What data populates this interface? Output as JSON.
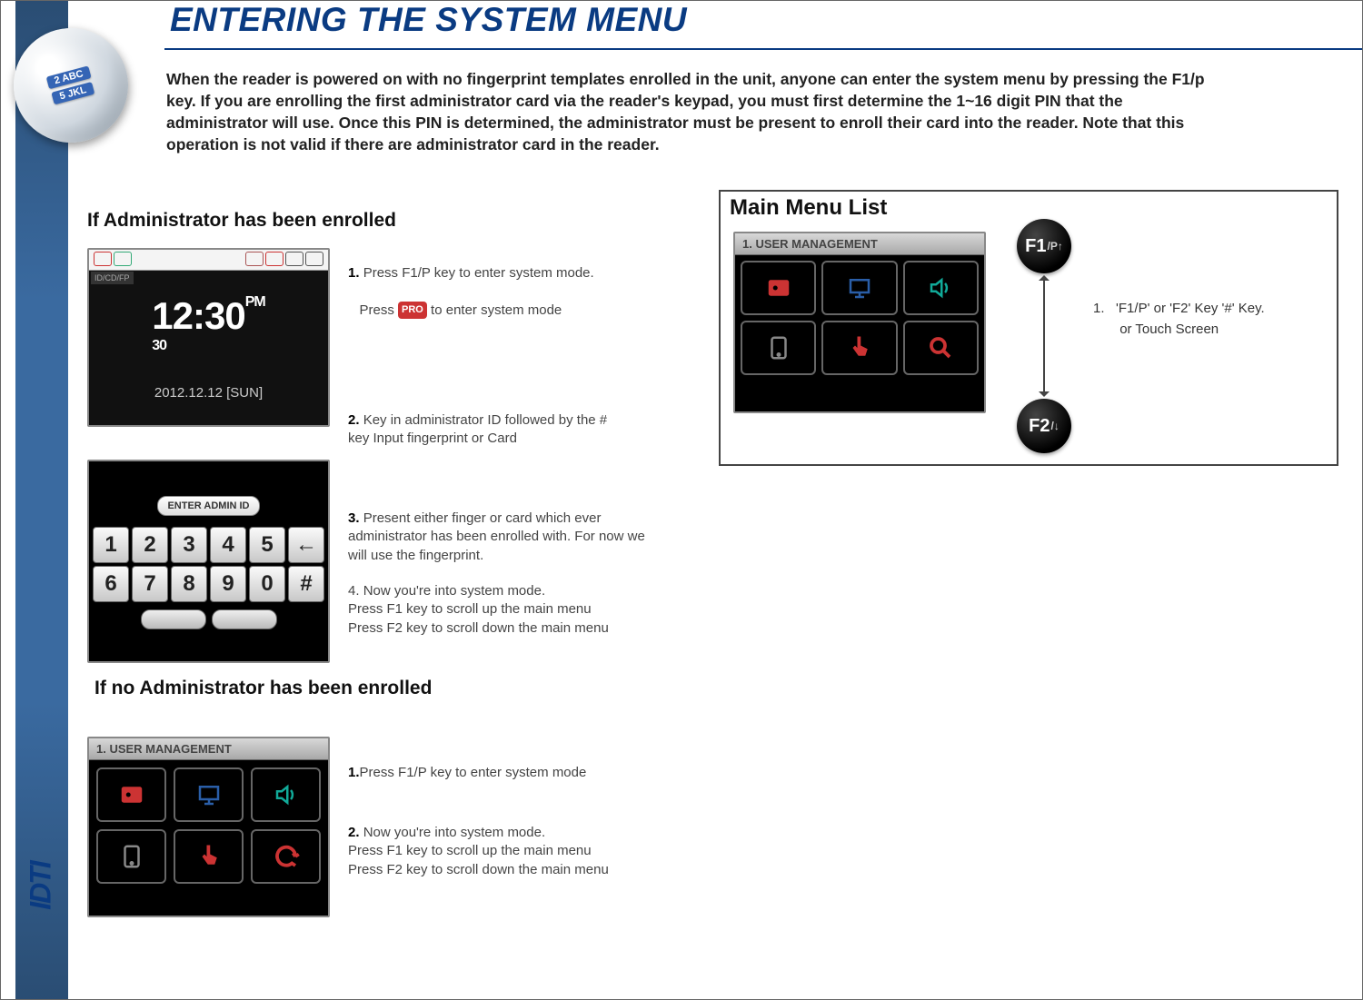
{
  "title": "ENTERING THE SYSTEM MENU",
  "intro": "When the reader is powered on with no fingerprint templates enrolled in the unit, anyone can enter the system menu by pressing the F1/p key. If you are enrolling the first administrator card via the reader's keypad, you must first determine the 1~16 digit PIN that the administrator will use. Once this PIN is determined, the administrator must be present to enroll their card into the reader. Note that this operation is not valid if there are administrator card in the reader.",
  "section1": {
    "heading": "If Administrator has been enrolled",
    "steps": [
      {
        "num": "1.",
        "text": "Press F1/P key to enter system mode.",
        "sub_a": "Press ",
        "sub_b": "  to enter system mode"
      },
      {
        "num": "2.",
        "text": "Key in administrator ID followed by the # key Input fingerprint  or Card"
      },
      {
        "num": "3.",
        "text": "Present either finger or card which ever administrator has been enrolled with. For now we will use the fingerprint."
      },
      {
        "num": "4.",
        "text": "Now you're into system mode.\nPress F1 key to scroll up the main menu\nPress F2 key to scroll down the main menu"
      }
    ]
  },
  "section2": {
    "heading": "If no Administrator has been enrolled",
    "steps": [
      {
        "num": "1.",
        "text": "Press F1/P key to enter system mode"
      },
      {
        "num": "2.",
        "text": "Now you're into system mode.\nPress F1 key to scroll up the main menu\nPress F2 key to scroll down the main menu"
      }
    ]
  },
  "shots": {
    "clock": {
      "mode": "ID/CD/FP",
      "time": "12:30",
      "ampm": "PM\n30",
      "date": "2012.12.12 [SUN]"
    },
    "keypad": {
      "label": "ENTER ADMIN ID",
      "keys": [
        "1",
        "2",
        "3",
        "4",
        "5",
        "←",
        "6",
        "7",
        "8",
        "9",
        "0",
        "#"
      ]
    },
    "menu": {
      "header": "1. USER MANAGEMENT"
    }
  },
  "mml": {
    "title": "Main Menu List",
    "f1": {
      "main": "F1",
      "sub": "/P↑"
    },
    "f2": {
      "main": "F2",
      "sub": "/↓"
    },
    "note_num": "1.",
    "note_line1": "'F1/P' or 'F2'  Key  '#' Key.",
    "note_line2": "or Touch Screen"
  },
  "decor": {
    "ball1": "2 ABC",
    "ball2": "5 JKL",
    "pro": "PRO",
    "footer_logo": "IDTI"
  }
}
